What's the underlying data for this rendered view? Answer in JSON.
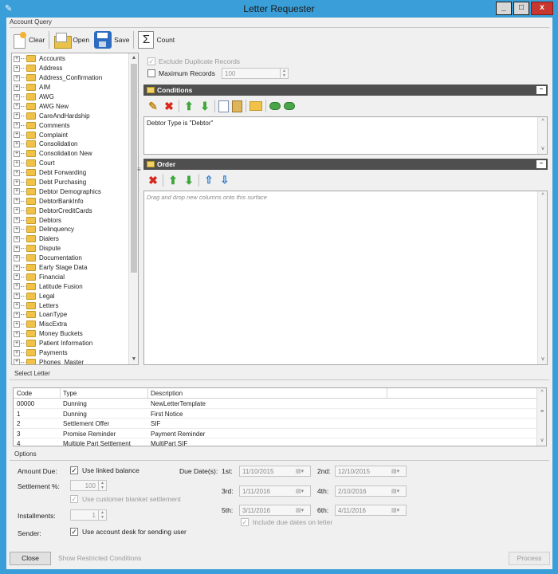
{
  "window": {
    "title": "Letter Requester",
    "controls": {
      "minimize": "_",
      "maximize": "□",
      "close": "x"
    }
  },
  "account_query": {
    "group_label": "Account Query",
    "toolbar": {
      "clear": "Clear",
      "open": "Open",
      "save": "Save",
      "count": "Count"
    },
    "tree_items": [
      "Accounts",
      "Address",
      "Address_Confirmation",
      "AIM",
      "AWG",
      "AWG New",
      "CareAndHardship",
      "Comments",
      "Complaint",
      "Consolidation",
      "Consolidation New",
      "Court",
      "Debt Forwarding",
      "Debt Purchasing",
      "Debtor Demographics",
      "DebtorBankInfo",
      "DebtorCreditCards",
      "Debtors",
      "Delinquency",
      "Dialers",
      "Dispute",
      "Documentation",
      "Early Stage Data",
      "Financial",
      "Latitude Fusion",
      "Legal",
      "Letters",
      "LoanType",
      "MiscExtra",
      "Money Buckets",
      "Patient Information",
      "Payments",
      "Phones_Master"
    ],
    "exclude_duplicates": "Exclude Duplicate Records",
    "max_records_label": "Maximum Records",
    "max_records_value": "100",
    "conditions_header": "Conditions",
    "conditions_text": "Debtor Type is \"Debtor\"",
    "order_header": "Order",
    "order_hint": "Drag and drop new columns onto this surface"
  },
  "select_letter": {
    "group_label": "Select Letter",
    "columns": [
      "Code",
      "Type",
      "Description"
    ],
    "rows": [
      {
        "code": "00000",
        "type": "Dunning",
        "description": "NewLetterTemplate"
      },
      {
        "code": "1",
        "type": "Dunning",
        "description": "First Notice"
      },
      {
        "code": "2",
        "type": "Settlement Offer",
        "description": "SIF"
      },
      {
        "code": "3",
        "type": "Promise Reminder",
        "description": "Payment Reminder"
      },
      {
        "code": "4",
        "type": "Multiple Part Settlement",
        "description": "MultiPart SIF"
      }
    ]
  },
  "options": {
    "group_label": "Options",
    "amount_due_label": "Amount Due:",
    "use_linked_balance": "Use linked balance",
    "settlement_label": "Settlement %:",
    "settlement_value": "100",
    "use_customer_blanket": "Use customer blanket settlement",
    "installments_label": "Installments:",
    "installments_value": "1",
    "sender_label": "Sender:",
    "use_account_desk": "Use account desk for sending user",
    "due_dates_label": "Due Date(s):",
    "due_dates": [
      {
        "label": "1st:",
        "value": "11/10/2015"
      },
      {
        "label": "2nd:",
        "value": "12/10/2015"
      },
      {
        "label": "3rd:",
        "value": "1/11/2016"
      },
      {
        "label": "4th:",
        "value": "2/10/2016"
      },
      {
        "label": "5th:",
        "value": "3/11/2016"
      },
      {
        "label": "6th:",
        "value": "4/11/2016"
      }
    ],
    "include_due_dates": "Include due dates on letter"
  },
  "footer": {
    "close": "Close",
    "show_restricted": "Show Restricted Conditions",
    "process": "Process"
  }
}
